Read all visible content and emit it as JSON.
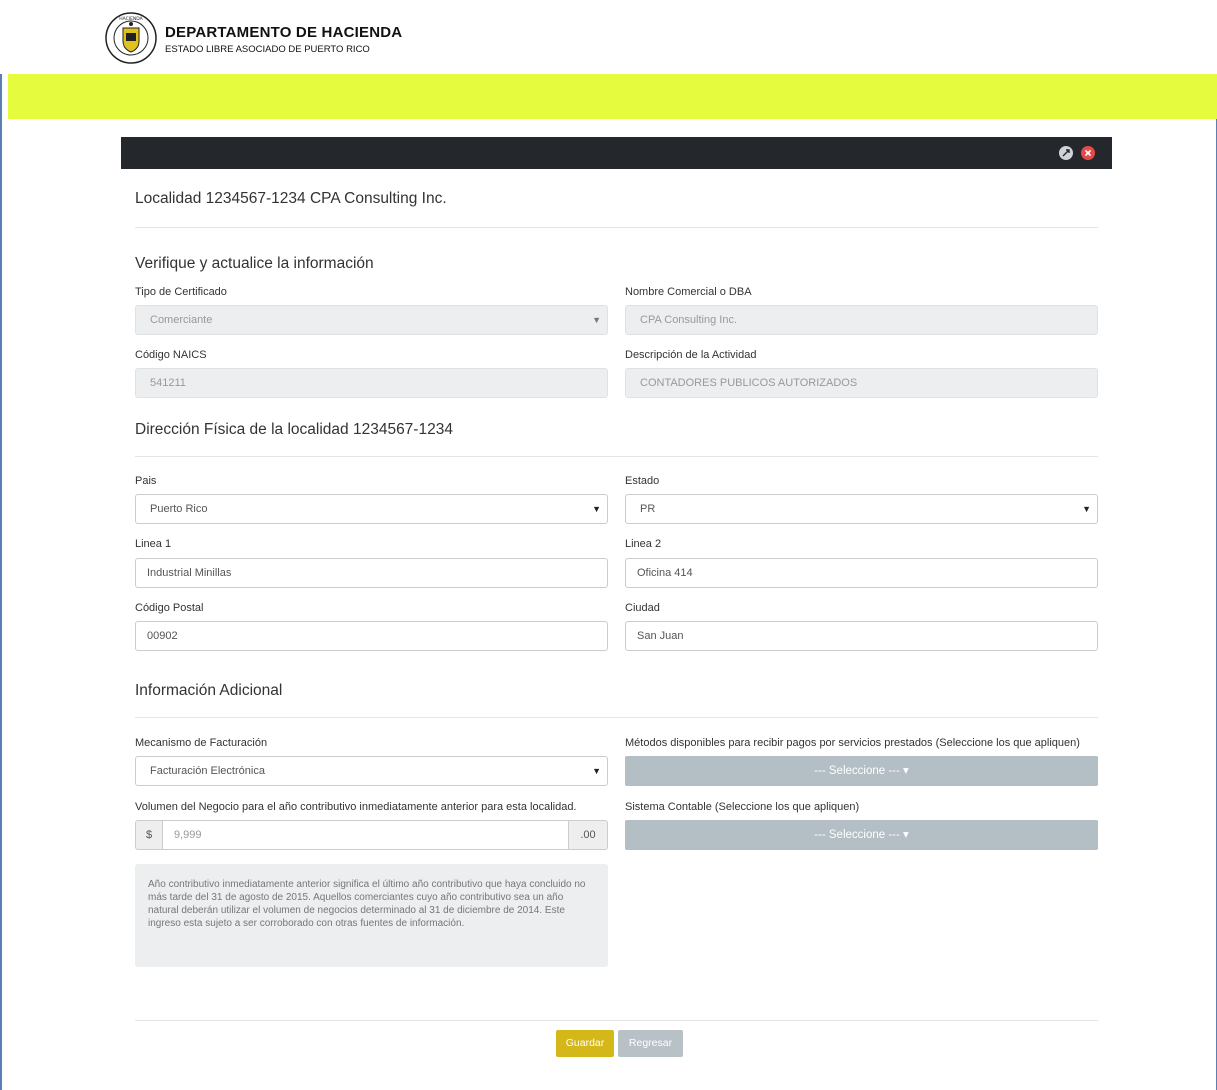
{
  "header": {
    "agency_name": "DEPARTAMENTO DE HACIENDA",
    "agency_subtitle": "ESTADO LIBRE ASOCIADO DE PUERTO RICO",
    "seal_text": "HACIENDA · ESTADO LIBRE ASOCIADO DE PUERTO RICO"
  },
  "panel": {
    "title": "Localidad 1234567-1234 CPA Consulting Inc.",
    "icons": [
      "expand-icon",
      "close-icon"
    ]
  },
  "verify": {
    "heading": "Verifique y actualice la información",
    "cert_type_label": "Tipo de Certificado",
    "cert_type_value": "Comerciante",
    "dba_label": "Nombre Comercial o DBA",
    "dba_value": "CPA Consulting Inc.",
    "naics_label": "Código NAICS",
    "naics_value": "541211",
    "activity_label": "Descripción de la Actividad",
    "activity_value": "CONTADORES PUBLICOS AUTORIZADOS"
  },
  "address": {
    "heading": "Dirección Física de la localidad 1234567-1234",
    "country_label": "Pais",
    "country_value": "Puerto Rico",
    "state_label": "Estado",
    "state_value": "PR",
    "line1_label": "Linea 1",
    "line1_value": "Industrial Minillas",
    "line2_label": "Linea 2",
    "line2_value": "Oficina 414",
    "zip_label": "Código Postal",
    "zip_value": "00902",
    "city_label": "Ciudad",
    "city_value": "San Juan"
  },
  "additional": {
    "heading": "Información Adicional",
    "billing_label": "Mecanismo de Facturación",
    "billing_value": "Facturación Electrónica",
    "payments_label": "Métodos disponibles para recibir pagos por servicios prestados (Seleccione los que apliquen)",
    "payments_button": "--- Seleccione --- ▾",
    "volume_label": "Volumen del Negocio para el año contributivo inmediatamente anterior para esta localidad.",
    "volume_prefix": "$",
    "volume_placeholder": "9,999",
    "volume_suffix": ".00",
    "accounting_label": "Sistema Contable (Seleccione los que apliquen)",
    "accounting_button": "--- Seleccione --- ▾",
    "note": "Año contributivo inmediatamente anterior significa el último año contributivo que haya concluido no más tarde del 31 de agosto de 2015. Aquellos comerciantes cuyo año contributivo sea un año natural deberán utilizar el volumen de negocios determinado al 31 de diciembre de 2014. Este ingreso esta sujeto a ser corroborado con otras fuentes de información."
  },
  "actions": {
    "save_label": "Guardar",
    "back_label": "Regresar"
  },
  "colors": {
    "accent_band": "#e4fb3e",
    "panel_bar": "#24272b",
    "save_button": "#d4b81a",
    "back_button": "#b8c1c6",
    "multiselect": "#b3bec5"
  }
}
